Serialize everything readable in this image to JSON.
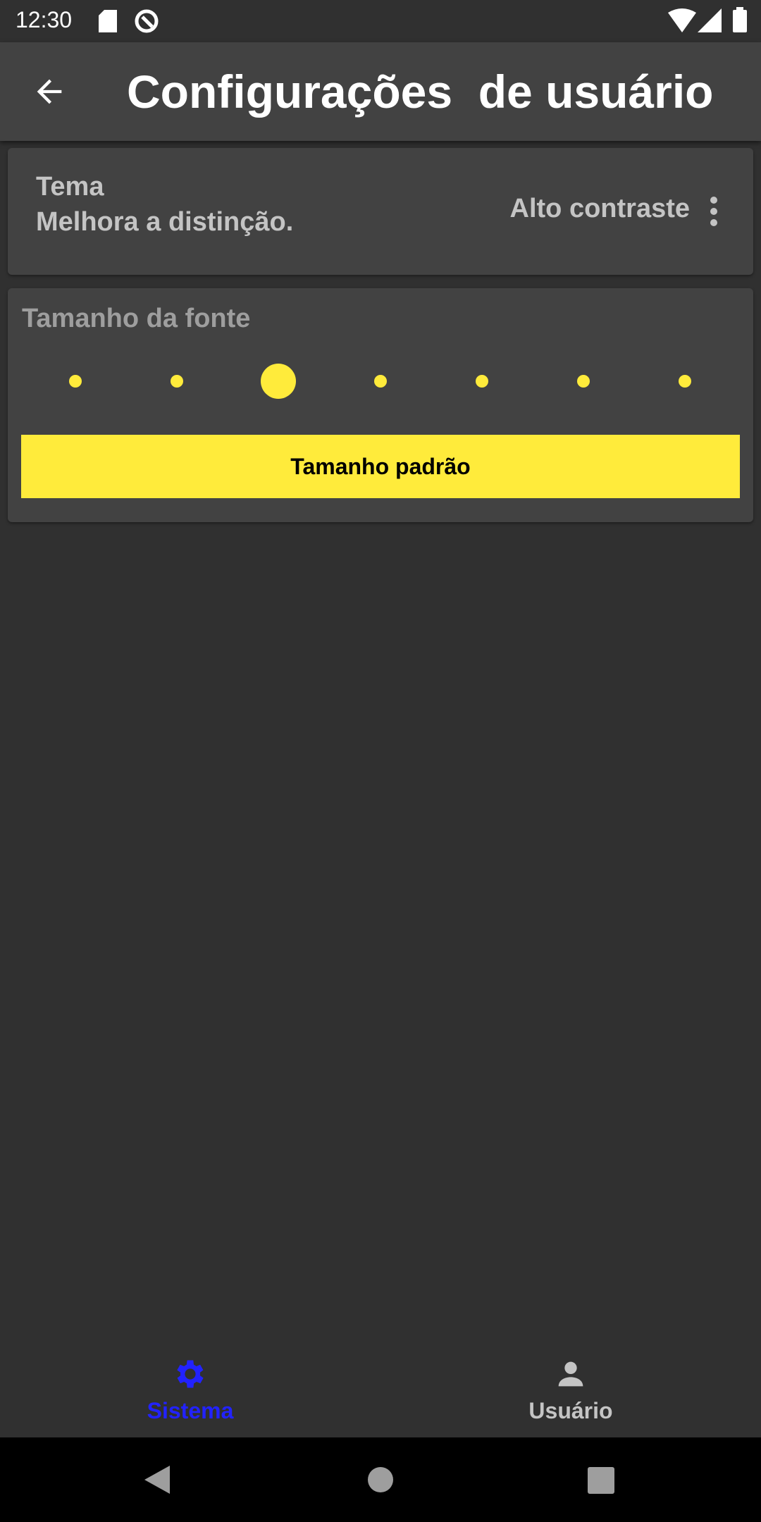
{
  "status_bar": {
    "time": "12:30",
    "icons": [
      "sd-card-icon",
      "data-saver-icon",
      "wifi-icon",
      "signal-icon",
      "battery-icon"
    ]
  },
  "app_bar": {
    "title": "Configurações  de usuário",
    "back_icon": "arrow-left-icon"
  },
  "theme_card": {
    "title": "Tema",
    "subtitle": "Melhora a distinção.",
    "value": "Alto contraste",
    "menu_icon": "more-vertical-icon"
  },
  "font_card": {
    "label": "Tamanho da fonte",
    "steps": 7,
    "selected_step": 3,
    "button_label": "Tamanho padrão"
  },
  "bottom_nav": {
    "items": [
      {
        "label": "Sistema",
        "icon": "gear-icon",
        "active": true
      },
      {
        "label": "Usuário",
        "icon": "person-icon",
        "active": false
      }
    ]
  },
  "colors": {
    "accent": "#ffeb3b",
    "active_nav": "#2222ff",
    "background": "#303030",
    "card": "#424242"
  }
}
